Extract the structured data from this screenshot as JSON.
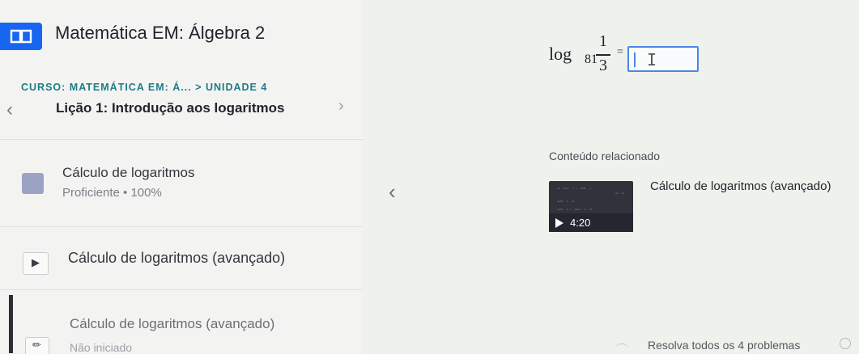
{
  "header": {
    "course_title": "Matemática EM: Álgebra 2",
    "logo_icon": "book-icon",
    "brand_color": "#1865f2"
  },
  "breadcrumb": "CURSO: MATEMÁTICA EM: Á... > UNIDADE 4",
  "lesson": {
    "title": "Lição 1: Introdução aos logaritmos",
    "prev_icon": "chevron-left-icon",
    "next_icon": "chevron-right-icon",
    "prev_glyph": "‹",
    "next_glyph": "›"
  },
  "items": {
    "skill": {
      "title": "Cálculo de logaritmos",
      "status": "Proficiente • 100%"
    },
    "video": {
      "title": "Cálculo de logaritmos (avançado)",
      "icon": "play-icon",
      "icon_glyph": "▶"
    },
    "exercise": {
      "title": "Cálculo de logaritmos (avançado)",
      "status": "Não iniciado",
      "icon": "pencil-icon",
      "icon_glyph": "✏"
    }
  },
  "problem": {
    "log": "log",
    "base": "81",
    "numerator": "1",
    "denominator": "3",
    "equals": "="
  },
  "related": {
    "header": "Conteúdo relacionado",
    "prev_glyph": "‹",
    "video_title": "Cálculo de logaritmos (avançado)",
    "duration": "4:20"
  },
  "footer": {
    "text": "Resolva todos os 4 problemas"
  }
}
